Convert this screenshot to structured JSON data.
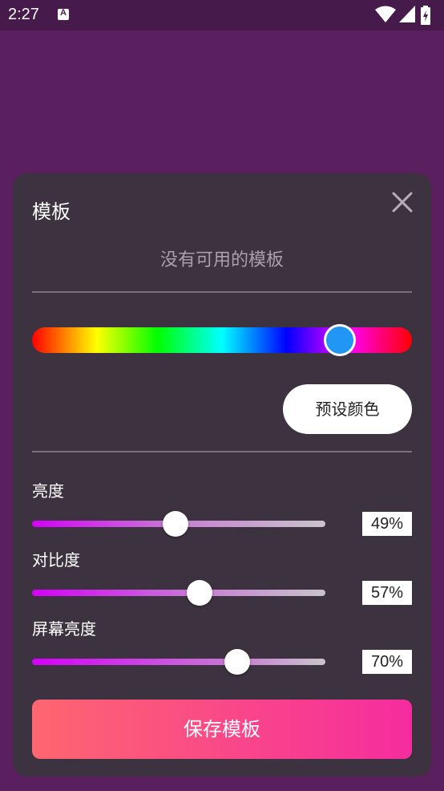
{
  "status_bar": {
    "time": "2:27",
    "icons": [
      "app-notification-icon",
      "wifi-icon",
      "cell-signal-icon",
      "battery-charging-icon"
    ]
  },
  "sheet": {
    "title": "模板",
    "empty_message": "没有可用的模板",
    "hue_slider": {
      "selected_color": "#2196f3",
      "position_fraction": 0.81
    },
    "preset_button_label": "预设颜色",
    "sliders": [
      {
        "label": "亮度",
        "value_text": "49%",
        "fraction": 0.49
      },
      {
        "label": "对比度",
        "value_text": "57%",
        "fraction": 0.57
      },
      {
        "label": "屏幕亮度",
        "value_text": "70%",
        "fraction": 0.7
      }
    ],
    "save_button_label": "保存模板"
  },
  "colors": {
    "background": "#5a1f5e",
    "sheet": "#3d323f",
    "accent_purple": "#d500f9",
    "save_gradient_start": "#fe6670",
    "save_gradient_end": "#f52c9f"
  }
}
